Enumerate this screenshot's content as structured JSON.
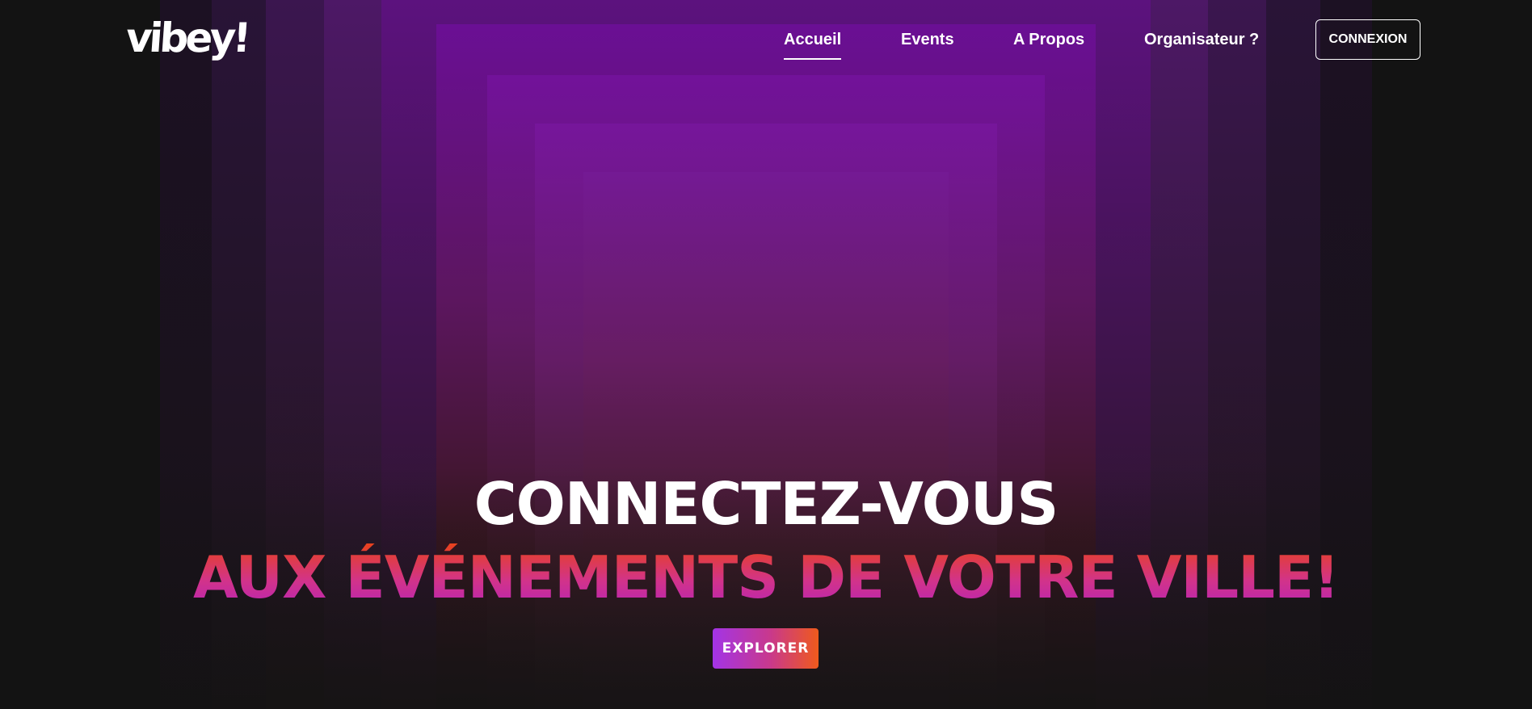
{
  "brand": {
    "logo_text": "vibey!"
  },
  "nav": {
    "items": [
      {
        "label": "Accueil",
        "active": true
      },
      {
        "label": "Events",
        "active": false
      },
      {
        "label": "A Propos",
        "active": false
      },
      {
        "label": "Organisateur ?",
        "active": false
      }
    ],
    "login_label": "CONNEXION"
  },
  "hero": {
    "line1": "CONNECTEZ-VOUS",
    "line2": "AUX ÉVÉNEMENTS DE VOTRE VILLE!",
    "cta_label": "EXPLORER"
  },
  "colors": {
    "background": "#131313",
    "accent_purple": "#a334e6",
    "accent_orange": "#ef5a1c",
    "accent_pink": "#d2338a"
  }
}
